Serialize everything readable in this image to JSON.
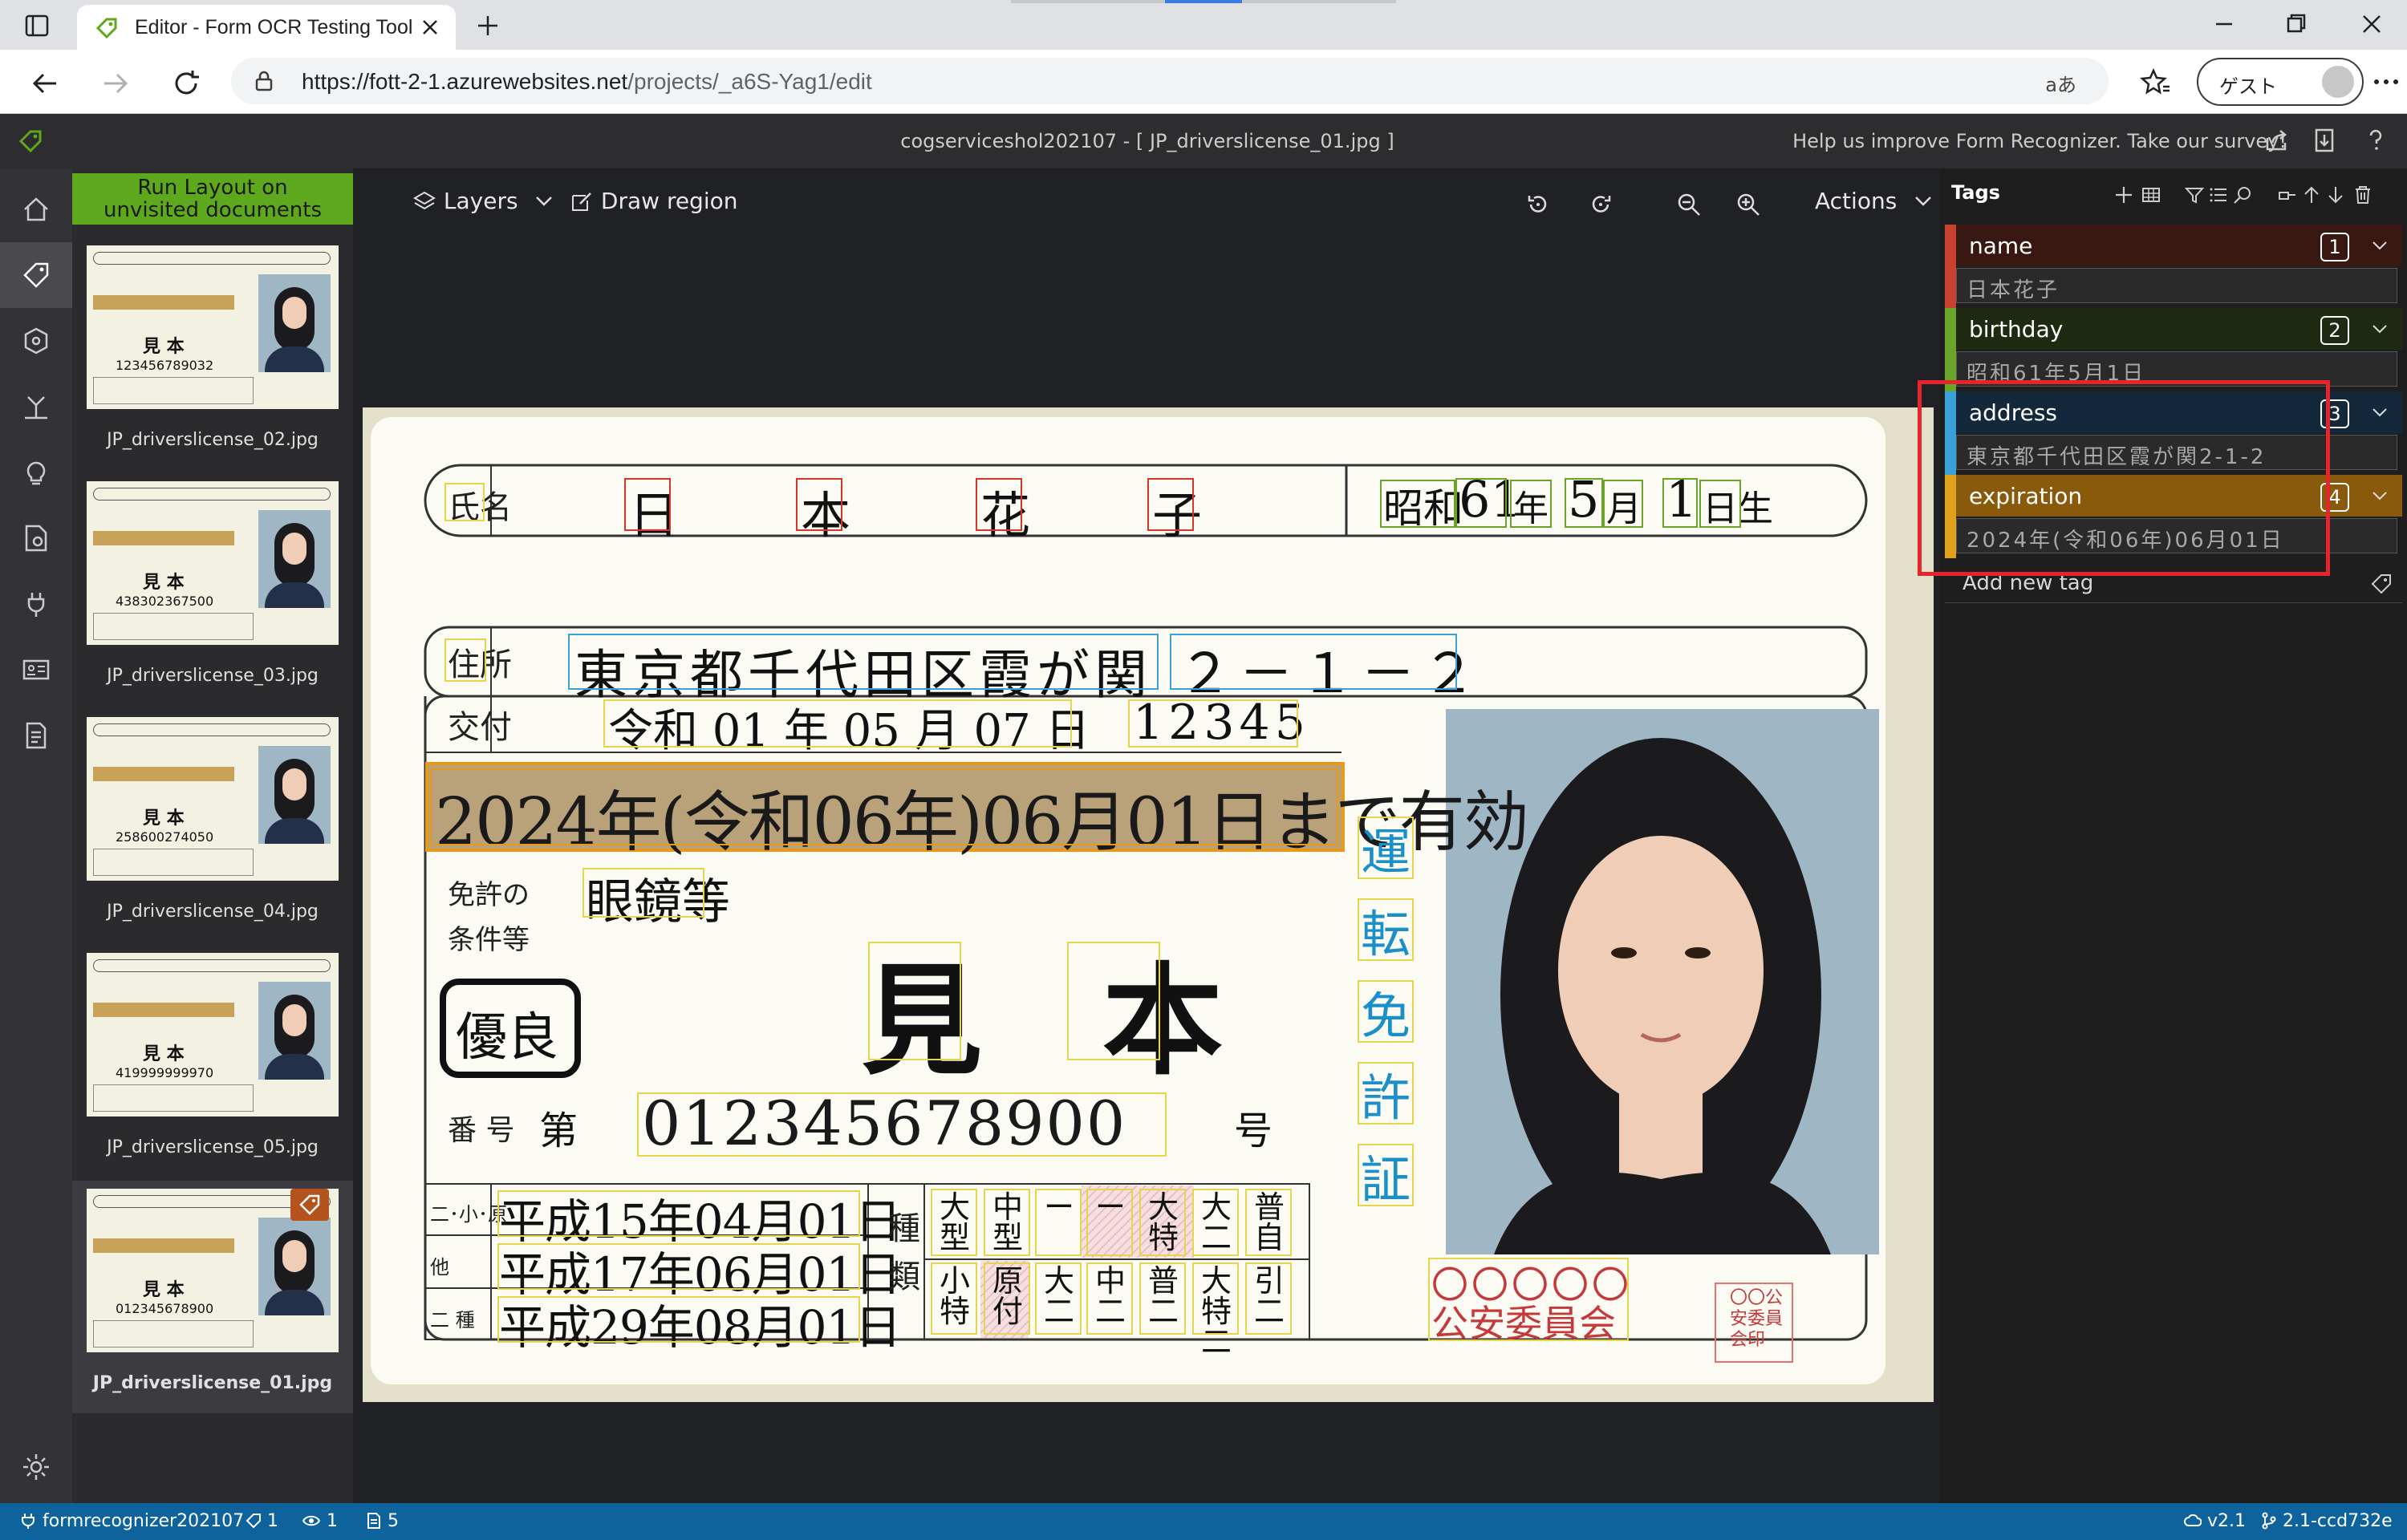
{
  "browser": {
    "tab_title": "Editor - Form OCR Testing Tool",
    "url_host": "https://fott-2-1.azurewebsites.net",
    "url_path": "/projects/_a6S-Yag1/edit",
    "read_aloud": "aあ",
    "guest_label": "ゲスト"
  },
  "app": {
    "title": "cogserviceshol202107 - [ JP_driverslicense_01.jpg ]",
    "survey": "Help us improve Form Recognizer. Take our survey!"
  },
  "thumbnails": {
    "run_layout_line1": "Run Layout on",
    "run_layout_line2": "unvisited documents",
    "items": [
      {
        "label": "JP_driverslicense_02.jpg",
        "name": "見 本",
        "number": "123456789032",
        "selected": false
      },
      {
        "label": "JP_driverslicense_03.jpg",
        "name": "見 本",
        "number": "438302367500",
        "selected": false
      },
      {
        "label": "JP_driverslicense_04.jpg",
        "name": "見 本",
        "number": "258600274050",
        "selected": false
      },
      {
        "label": "JP_driverslicense_05.jpg",
        "name": "見 本",
        "number": "419999999970",
        "selected": false
      },
      {
        "label": "JP_driverslicense_01.jpg",
        "name": "見 本",
        "number": "012345678900",
        "selected": true
      }
    ]
  },
  "toolbar": {
    "layers": "Layers",
    "draw_region": "Draw region",
    "actions": "Actions"
  },
  "license": {
    "name_label": "氏名",
    "name_chars": [
      "日",
      "本",
      "花",
      "子"
    ],
    "birth_era": "昭和",
    "birth_year": "61",
    "birth_year_unit": "年",
    "birth_month": "5",
    "birth_month_unit": "月",
    "birth_day": "1",
    "birth_day_unit": "日生",
    "address_label": "住所",
    "address_value": "東京都千代田区霞が関",
    "address_number": "２－１－２",
    "issue_label": "交付",
    "issue_value": "令和 01 年 05 月 07 日",
    "issue_code": "12345",
    "expiry_value": "2024年(令和06年)06月01日まで有効",
    "conditions_label_1": "免許の",
    "conditions_label_2": "条件等",
    "conditions_value": "眼鏡等",
    "sample_text": "見　本",
    "grade": "優良",
    "number_label": "番 号",
    "number_prefix": "第",
    "number_value": "012345678900",
    "number_suffix": "号",
    "history": [
      {
        "label": "二･小･原",
        "value": "平成15年04月01日"
      },
      {
        "label": "他",
        "value": "平成17年06月01日"
      },
      {
        "label": "二 種",
        "value": "平成29年08月01日"
      }
    ],
    "class_label": "種類",
    "class_cells_top": [
      "大型",
      "中型",
      "ー",
      "ー",
      "大特",
      "大二",
      "普自"
    ],
    "class_cells_bottom": [
      "小特",
      "原付",
      "大二",
      "中二",
      "普二",
      "大特二",
      "引二"
    ],
    "vertical_text": [
      "運",
      "転",
      "免",
      "許",
      "証"
    ],
    "commission": "公安委員会",
    "stamp": "〇〇〇〇〇",
    "seal": "〇〇公安委員会印"
  },
  "tags": {
    "header": "Tags",
    "items": [
      {
        "name": "name",
        "hotkey": "1",
        "value": "日本花子",
        "color": "#c8402e",
        "bg": "#3a1812"
      },
      {
        "name": "birthday",
        "hotkey": "2",
        "value": "昭和61年5月1日",
        "color": "#6aa52b",
        "bg": "#1f2a12"
      },
      {
        "name": "address",
        "hotkey": "3",
        "value": "東京都千代田区霞が関2-1-2",
        "color": "#3aa0d8",
        "bg": "#13283a"
      },
      {
        "name": "expiration",
        "hotkey": "4",
        "value": "2024年(令和06年)06月01日",
        "color": "#e0a21c",
        "bg": "#8a5a0c"
      }
    ],
    "add_new": "Add new tag"
  },
  "status": {
    "project": "formrecognizer202107",
    "tags_count": "1",
    "visited_count": "1",
    "docs_count": "5",
    "api_version": "v2.1",
    "build": "2.1-ccd732e"
  }
}
